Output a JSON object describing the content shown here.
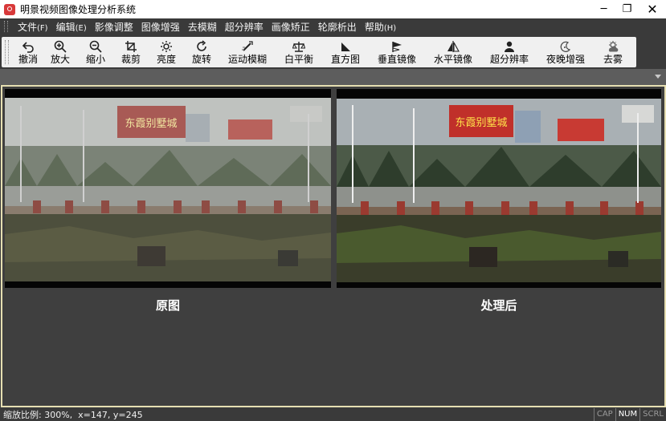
{
  "window": {
    "title": "明景视频图像处理分析系统",
    "minimize_glyph": "─",
    "maximize_glyph": "❐",
    "close_glyph": "✕"
  },
  "menu": [
    {
      "label": "文件",
      "accel": "(F)"
    },
    {
      "label": "编辑",
      "accel": "(E)"
    },
    {
      "label": "影像调整",
      "accel": ""
    },
    {
      "label": "图像增强",
      "accel": ""
    },
    {
      "label": "去模糊",
      "accel": ""
    },
    {
      "label": "超分辨率",
      "accel": ""
    },
    {
      "label": "画像矫正",
      "accel": ""
    },
    {
      "label": "轮廓析出",
      "accel": ""
    },
    {
      "label": "帮助",
      "accel": "(H)"
    }
  ],
  "toolbar": [
    {
      "label": "撤消",
      "icon": "undo-icon"
    },
    {
      "label": "放大",
      "icon": "zoom-in-icon"
    },
    {
      "label": "缩小",
      "icon": "zoom-out-icon"
    },
    {
      "label": "裁剪",
      "icon": "crop-icon"
    },
    {
      "label": "亮度",
      "icon": "brightness-icon"
    },
    {
      "label": "旋转",
      "icon": "rotate-icon"
    },
    {
      "label": "运动模糊",
      "icon": "motion-blur-icon"
    },
    {
      "label": "白平衡",
      "icon": "white-balance-icon"
    },
    {
      "label": "直方图",
      "icon": "histogram-icon"
    },
    {
      "label": "垂直镜像",
      "icon": "vertical-mirror-icon"
    },
    {
      "label": "水平镜像",
      "icon": "horizontal-mirror-icon"
    },
    {
      "label": "超分辨率",
      "icon": "super-resolution-icon"
    },
    {
      "label": "夜晚增强",
      "icon": "night-enhance-icon"
    },
    {
      "label": "去雾",
      "icon": "defog-icon"
    }
  ],
  "panes": {
    "original": {
      "caption": "原图",
      "billboard_text": "东霞别墅城"
    },
    "processed": {
      "caption": "处理后",
      "billboard_text": "东霞别墅城"
    }
  },
  "statusbar": {
    "text": "缩放比例: 300%,  x=147, y=245",
    "indicators": [
      {
        "label": "CAP",
        "active": false
      },
      {
        "label": "NUM",
        "active": true
      },
      {
        "label": "SCRL",
        "active": false
      }
    ]
  }
}
